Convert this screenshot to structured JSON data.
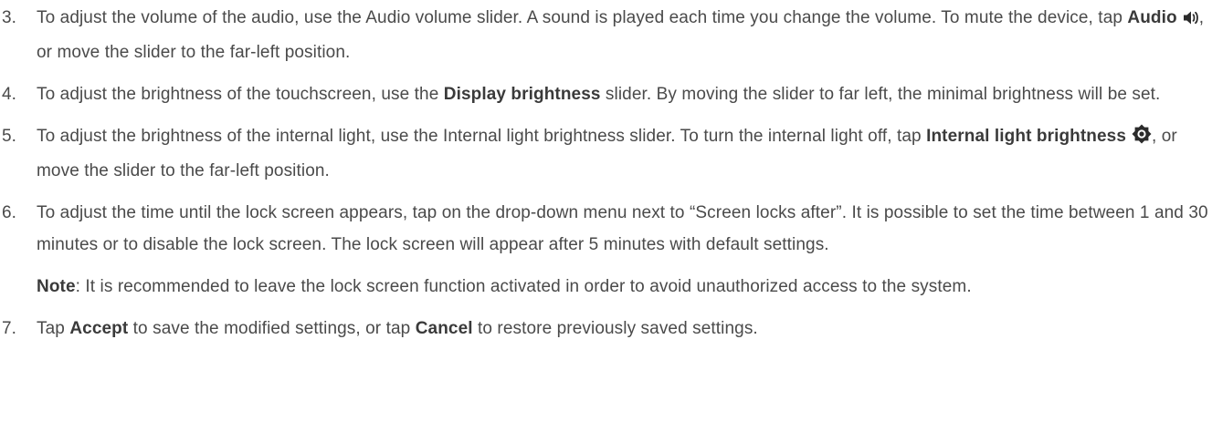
{
  "steps": [
    {
      "number": "3.",
      "a": "To adjust the volume of the audio, use the Audio volume slider. A sound is played each time you change the volume. To mute the device, tap ",
      "b1": "Audio",
      "c": ", or move the slider to the far-left position.",
      "icon": "speaker-icon"
    },
    {
      "number": "4.",
      "a": "To adjust the brightness of the touchscreen, use the ",
      "b1": "Display brightness",
      "c": " slider. By moving the slider to far left, the minimal brightness will be set."
    },
    {
      "number": "5.",
      "a": "To adjust the brightness of the internal light, use the Internal light brightness slider. To turn the internal light off, tap ",
      "b1": "Internal light brightness",
      "c": ", or move the slider to the far-left position.",
      "icon": "brightness-icon"
    },
    {
      "number": "6.",
      "a": "To adjust the time until the lock screen appears, tap on the drop-down menu next to “Screen locks after”. It is possible to set the time between 1 and 30 minutes or to disable the lock screen. The lock screen will appear after 5 minutes with default settings."
    },
    {
      "number": "7.",
      "a": "Tap ",
      "b1": "Accept",
      "c": " to save the modified settings, or tap ",
      "b2": "Cancel",
      "d": " to restore previously saved settings."
    }
  ],
  "note": {
    "label": "Note",
    "text": ": It is recommended to leave the lock screen function activated in order to avoid unauthorized access to the system."
  }
}
